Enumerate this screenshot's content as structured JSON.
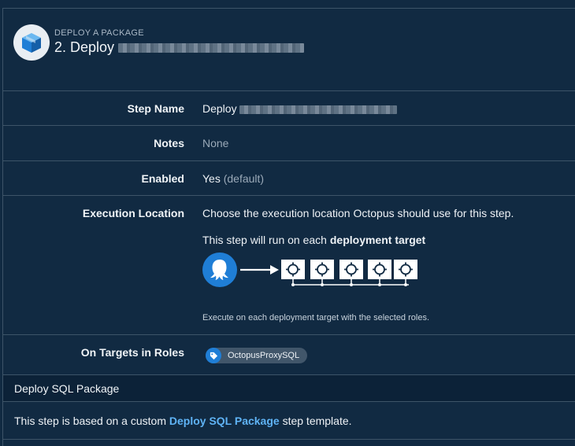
{
  "header": {
    "overline": "DEPLOY A PACKAGE",
    "title_prefix": "2. Deploy"
  },
  "fields": {
    "step_name": {
      "label": "Step Name",
      "value_prefix": "Deploy"
    },
    "notes": {
      "label": "Notes",
      "value": "None"
    },
    "enabled": {
      "label": "Enabled",
      "value": "Yes",
      "suffix": "(default)"
    },
    "execution_location": {
      "label": "Execution Location",
      "line1": "Choose the execution location Octopus should use for this step.",
      "line2_prefix": "This step will run on each ",
      "line2_bold": "deployment target",
      "caption": "Execute on each deployment target with the selected roles."
    },
    "target_roles": {
      "label": "On Targets in Roles",
      "roles": [
        "OctopusProxySQL"
      ]
    }
  },
  "section": {
    "title": "Deploy SQL Package",
    "text_prefix": "This step is based on a custom ",
    "link": "Deploy SQL Package",
    "text_suffix": " step template."
  },
  "colors": {
    "background": "#112a42",
    "accent_blue": "#1f7ed6",
    "link": "#5fb3f5",
    "border": "#3d5468"
  },
  "icons": {
    "package": "package-icon",
    "octopus": "octopus-icon",
    "target": "deployment-target-icon",
    "tag": "tag-icon"
  }
}
